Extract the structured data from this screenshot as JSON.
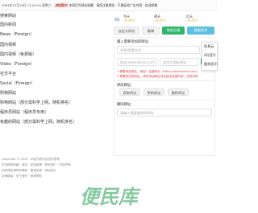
{
  "topbar": {
    "date": "2081年12月18日 11:04:24 星期三 · 上午好",
    "notice_prefix": "欢迎您的",
    "notice_text": "本网页为网址收藏 · 请您注意辨别 · 不要轻信广告内容 · 欢迎投稿"
  },
  "sidebar": {
    "items": [
      "搜索网站",
      "国内新闻",
      "News（Foreign）",
      "国内视频",
      "国内视频（免费版）",
      "Video（Foreign）",
      "社交平台",
      "Social（Foreign）",
      "购物网站",
      "购物网站（部分需科学上网，随机排名）",
      "程序员网站（程序员专用）",
      "有趣的网站（部分需科学上网，随机排名）"
    ]
  },
  "weather": {
    "days": [
      {
        "name": "今天",
        "temp": "-4~6℃"
      },
      {
        "name": "明天",
        "temp": "-4~6℃"
      },
      {
        "name": "后天",
        "temp": "-4~6℃"
      }
    ]
  },
  "buttons": {
    "custom": "自定义网址",
    "edit": "编辑",
    "feedback": "常用反馈",
    "sync": "数据同步"
  },
  "card": {
    "section1_label": "输入需要添加的网址：",
    "name_placeholder": "名称/简要名字",
    "url_placeholder": "网址:www.baidu.com",
    "icon_placeholder": "自定义图标地址",
    "add_button": "添加",
    "note1": "1.需要添加网址，例如：百度网页（https://www.baidu.com）",
    "note2": "2.需要添加的网址，请勿添加网址涉及违法违规内容，否则封禁",
    "section2_label": "修改网址：",
    "mod_btn1": "获取网址",
    "mod_btn2": "更新网址",
    "mod_btn3": "删除网址",
    "section3_label": "删除网址：",
    "del_placeholder": "请输入需要删除的网址"
  },
  "dropdown": {
    "options": [
      "网易云",
      "QQ音乐",
      "酷狗音乐"
    ]
  },
  "footer": {
    "lines": [
      "Copyright © 2023 · 本站所有内容仅供参考",
      "本站推荐收藏 · 域名 · 欢迎投稿 · 联系我们 · 本站声明",
      "如有侵权请联系删除 · 备案信息 · 网站统计",
      "友情链接 · 关于我们 · 使用帮助"
    ]
  },
  "watermark": {
    "text": "便民库"
  },
  "colors": {
    "accent_green": "#2fb56a",
    "accent_teal": "#5bc0de",
    "alert_red": "#e23b3b",
    "watermark_green": "#86c9a0"
  }
}
